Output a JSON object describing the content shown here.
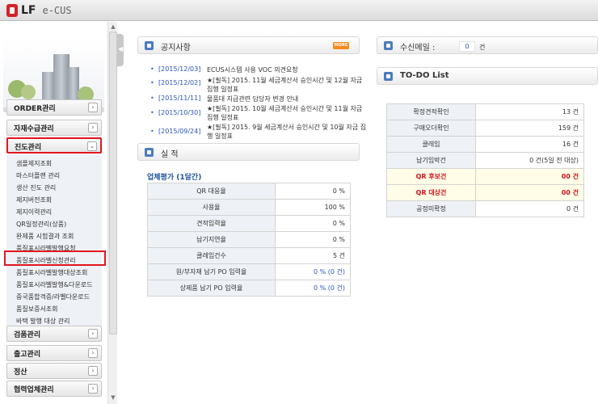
{
  "app": {
    "logo_brand": "LF",
    "logo_product": "e-CUS"
  },
  "sidebar": {
    "menus": [
      {
        "label": "ORDER관리",
        "btn": "›"
      },
      {
        "label": "자재수급관리",
        "btn": "›"
      },
      {
        "label": "진도관리",
        "btn": "⌄"
      },
      {
        "label": "검품관리",
        "btn": "›"
      },
      {
        "label": "출고관리",
        "btn": "›"
      },
      {
        "label": "정산",
        "btn": "›"
      },
      {
        "label": "협력업체관리",
        "btn": "›"
      }
    ],
    "submenu": [
      "샘플제지조회",
      "마스터플랜 관리",
      "생산 진도 관리",
      "제지버전조회",
      "제지이력관리",
      "QR일정관리(상품)",
      "완제품 시험결과 조회",
      "품질표시라벨발행요청",
      "품질표시라벨신청관리",
      "품질표시라벨발행대상조회",
      "품질표시라벨발행&다운로드",
      "중국품합격증/라벨다운로드",
      "품질보증서조회",
      "바택 발행 대상 관리"
    ]
  },
  "notices": {
    "title": "공지사항",
    "more": "MORE",
    "items": [
      {
        "date": "[2015/12/03]",
        "text": "ECUS시스템 사용 VOC 의견요청"
      },
      {
        "date": "[2015/12/02]",
        "text": "★[필독] 2015. 11월 세금계산서 승인시간 및 12월 자금 집행 일정표"
      },
      {
        "date": "[2015/11/11]",
        "text": "물품대 지급관련 담당자 변경 안내"
      },
      {
        "date": "[2015/10/30]",
        "text": "★[필독] 2015. 10월 세금계산서 승인시간 및 11월 자금 집행 일정표"
      },
      {
        "date": "[2015/09/24]",
        "text": "★[필독] 2015. 9월 세금계산서 승인시간 및 10월 자금 집행 일정표"
      }
    ]
  },
  "performance": {
    "title": "실 적",
    "subtitle": "업체평가 (1달간)",
    "rows": [
      {
        "label": "QR 대응율",
        "value": "0 %"
      },
      {
        "label": "사용율",
        "value": "100 %"
      },
      {
        "label": "견적입력율",
        "value": "0 %"
      },
      {
        "label": "납기지연율",
        "value": "0 %"
      },
      {
        "label": "클레임건수",
        "value": "5 건"
      },
      {
        "label": "원/부자재 납기 PO 입력율",
        "value": "0 % (0 건)"
      },
      {
        "label": "상제품 납기 PO 입력율",
        "value": "0 % (0 건)"
      }
    ]
  },
  "mail": {
    "title": "수신메일 :",
    "count": "0",
    "unit": "건"
  },
  "todo": {
    "title": "TO-DO List",
    "rows": [
      {
        "label": "확정견적확인",
        "value": "13 건"
      },
      {
        "label": "구매오더확인",
        "value": "159 건"
      },
      {
        "label": "클레임",
        "value": "16 건"
      },
      {
        "label": "납기임박건",
        "value": "0 건(5일 전 대상)"
      },
      {
        "label": "QR 후보건",
        "value": "00 건"
      },
      {
        "label": "QR 대상건",
        "value": "00 건"
      },
      {
        "label": "공정미확정",
        "value": "0 건"
      }
    ]
  }
}
